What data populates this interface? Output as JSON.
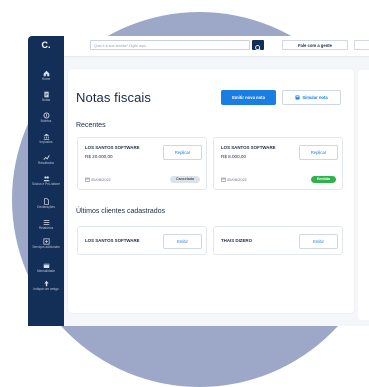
{
  "brand": {
    "logo_text": "C."
  },
  "sidebar": {
    "items": [
      {
        "label": "Home",
        "icon": "home-icon"
      },
      {
        "label": "Notas",
        "icon": "document-icon"
      },
      {
        "label": "Boletos",
        "icon": "barcode-icon"
      },
      {
        "label": "Impostos",
        "icon": "bank-icon"
      },
      {
        "label": "Resultados",
        "icon": "chart-icon"
      },
      {
        "label": "Sócios e Pró-labore",
        "icon": "people-icon"
      },
      {
        "label": "Declarações",
        "icon": "file-icon"
      },
      {
        "label": "Relatórios",
        "icon": "list-icon"
      },
      {
        "label": "Serviços adicionais",
        "icon": "plus-box-icon"
      },
      {
        "label": "Mensalidade",
        "icon": "wallet-icon"
      },
      {
        "label": "Indique um amigo",
        "icon": "gift-icon"
      }
    ]
  },
  "topbar": {
    "search_placeholder": "Qual é a sua dúvida? Digite aqui",
    "talk_button": "Fale com a gente"
  },
  "main": {
    "title": "Notas fiscais",
    "emit_new_button": "Emitir nova nota",
    "simulate_button": "Simular nota",
    "recent_title": "Recentes",
    "recent": [
      {
        "company": "LOS SANTOS SOFTWARE",
        "value": "R$ 20.000,00",
        "action": "Replicar",
        "date": "05/08/2021",
        "status": "Cancelada"
      },
      {
        "company": "LOS SANTOS SOFTWARE",
        "value": "R$ 8.000,00",
        "action": "Replicar",
        "date": "05/06/2021",
        "status": "Emitida"
      }
    ],
    "clients_title": "Últimos clientes cadastrados",
    "clients": [
      {
        "name": "LOS SANTOS SOFTWARE",
        "action": "Emitir"
      },
      {
        "name": "THAIS DIZERO",
        "action": "Emitir"
      }
    ]
  },
  "colors": {
    "sidebar_bg": "#142f57",
    "primary": "#1a7de2",
    "badge_cancelled_bg": "#dde1e8",
    "badge_issued_bg": "#2fb14c",
    "background_blob": "#9da7c7"
  }
}
